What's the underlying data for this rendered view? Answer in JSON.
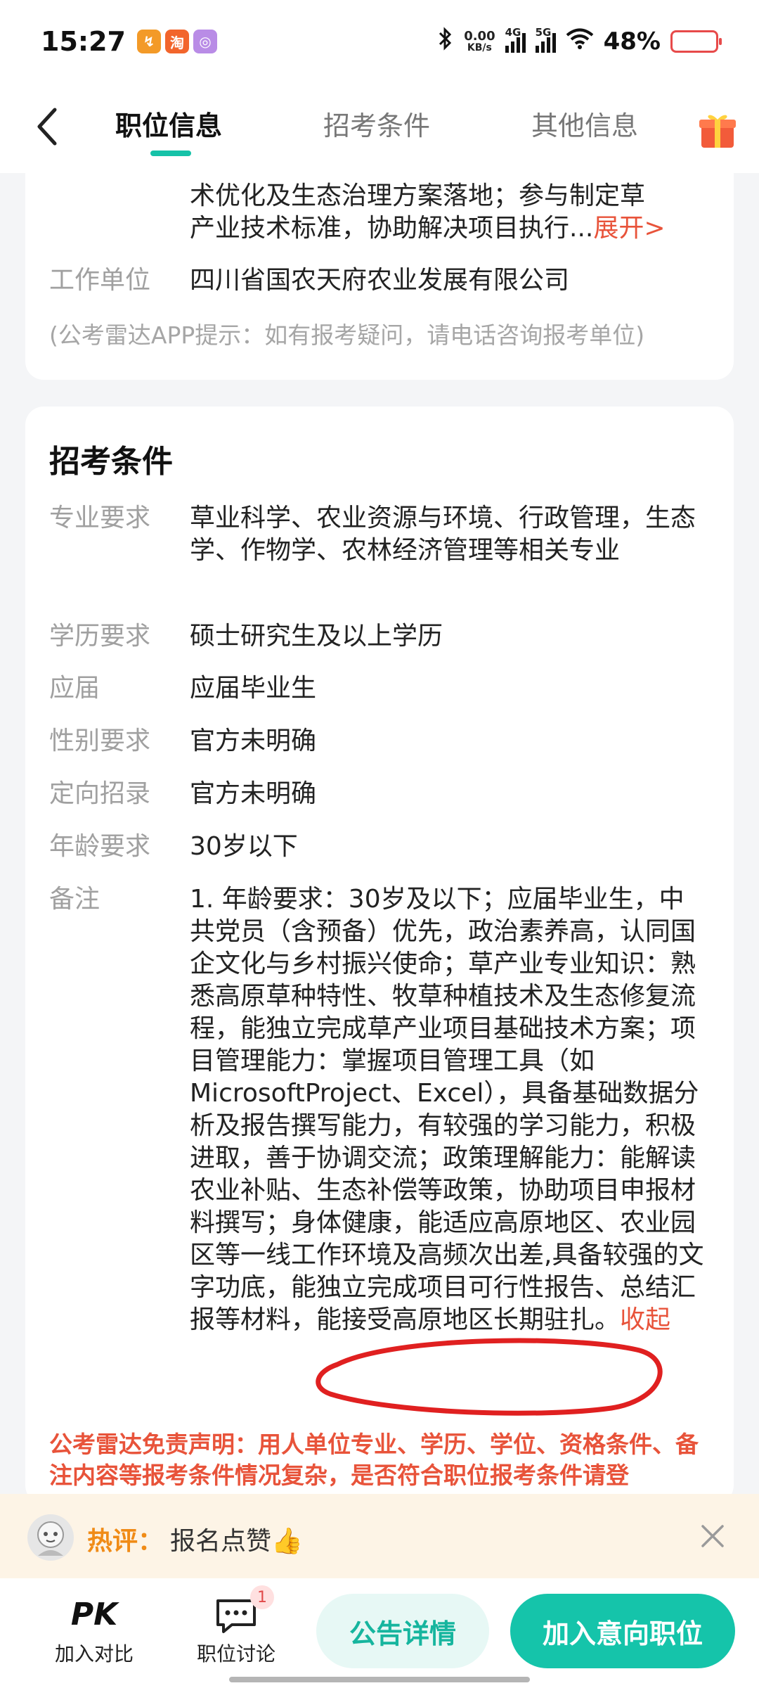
{
  "status_bar": {
    "time": "15:27",
    "apps": [
      {
        "icon": "app-orange-icon",
        "glyph": "↯",
        "color": "#f39a28"
      },
      {
        "icon": "taobao-icon",
        "glyph": "淘",
        "color": "#f2652c"
      },
      {
        "icon": "app-purple-icon",
        "glyph": "◎",
        "color": "#b98ce6"
      }
    ],
    "net_speed_value": "0.00",
    "net_speed_unit": "KB/s",
    "signal_4g": "4G",
    "signal_5g": "5G",
    "battery_pct": "48%",
    "battery_color": "#e74a4a"
  },
  "header": {
    "tabs": [
      {
        "label": "职位信息",
        "active": true
      },
      {
        "label": "招考条件",
        "active": false
      },
      {
        "label": "其他信息",
        "active": false
      }
    ],
    "accent": "#16c2a8"
  },
  "top_card": {
    "desc_line1": "术优化及生态治理方案落地；参与制定草",
    "desc_line2": "产业技术标准，协助解决项目执行...",
    "expand_label": "展开>",
    "employer_label": "工作单位",
    "employer_value": "四川省国农天府农业发展有限公司",
    "tip": "(公考雷达APP提示：如有报考疑问，请电话咨询报考单位)"
  },
  "conditions": {
    "title": "招考条件",
    "rows": [
      {
        "label": "专业要求",
        "value": "草业科学、农业资源与环境、行政管理，生态学、作物学、农林经济管理等相关专业"
      },
      {
        "label": "学历要求",
        "value": "硕士研究生及以上学历"
      },
      {
        "label": "应届",
        "value": "应届毕业生"
      },
      {
        "label": "性别要求",
        "value": "官方未明确"
      },
      {
        "label": "定向招录",
        "value": "官方未明确"
      },
      {
        "label": "年龄要求",
        "value": "30岁以下"
      }
    ],
    "remark_label": "备注",
    "remark_value": "1. 年龄要求：30岁及以下；应届毕业生，中共党员（含预备）优先，政治素养高，认同国企文化与乡村振兴使命；草产业专业知识：熟悉高原草种特性、牧草种植技术及生态修复流程，能独立完成草产业项目基础技术方案；项目管理能力：掌握项目管理工具（如MicrosoftProject、Excel），具备基础数据分析及报告撰写能力，有较强的学习能力，积极进取，善于协调交流；政策理解能力：能解读农业补贴、生态补偿等政策，协助项目申报材料撰写；身体健康，能适应高原地区、农业园区等一线工作环境及高频次出差,具备较强的文字功底，能独立完成项目可行性报告、总结汇报等材料，能接受高原地区长期驻扎。",
    "collapse_label": "收起",
    "disclaimer": "公考雷达免责声明：用人单位专业、学历、学位、资格条件、备注内容等报考条件情况复杂，是否符合职位报考条件请登"
  },
  "hot_comment": {
    "label": "热评：",
    "text": "报名点赞👍"
  },
  "bottom_bar": {
    "compare_icon": "PK",
    "compare_label": "加入对比",
    "discuss_label": "职位讨论",
    "discuss_badge": "1",
    "notice_button": "公告详情",
    "join_button": "加入意向职位"
  }
}
